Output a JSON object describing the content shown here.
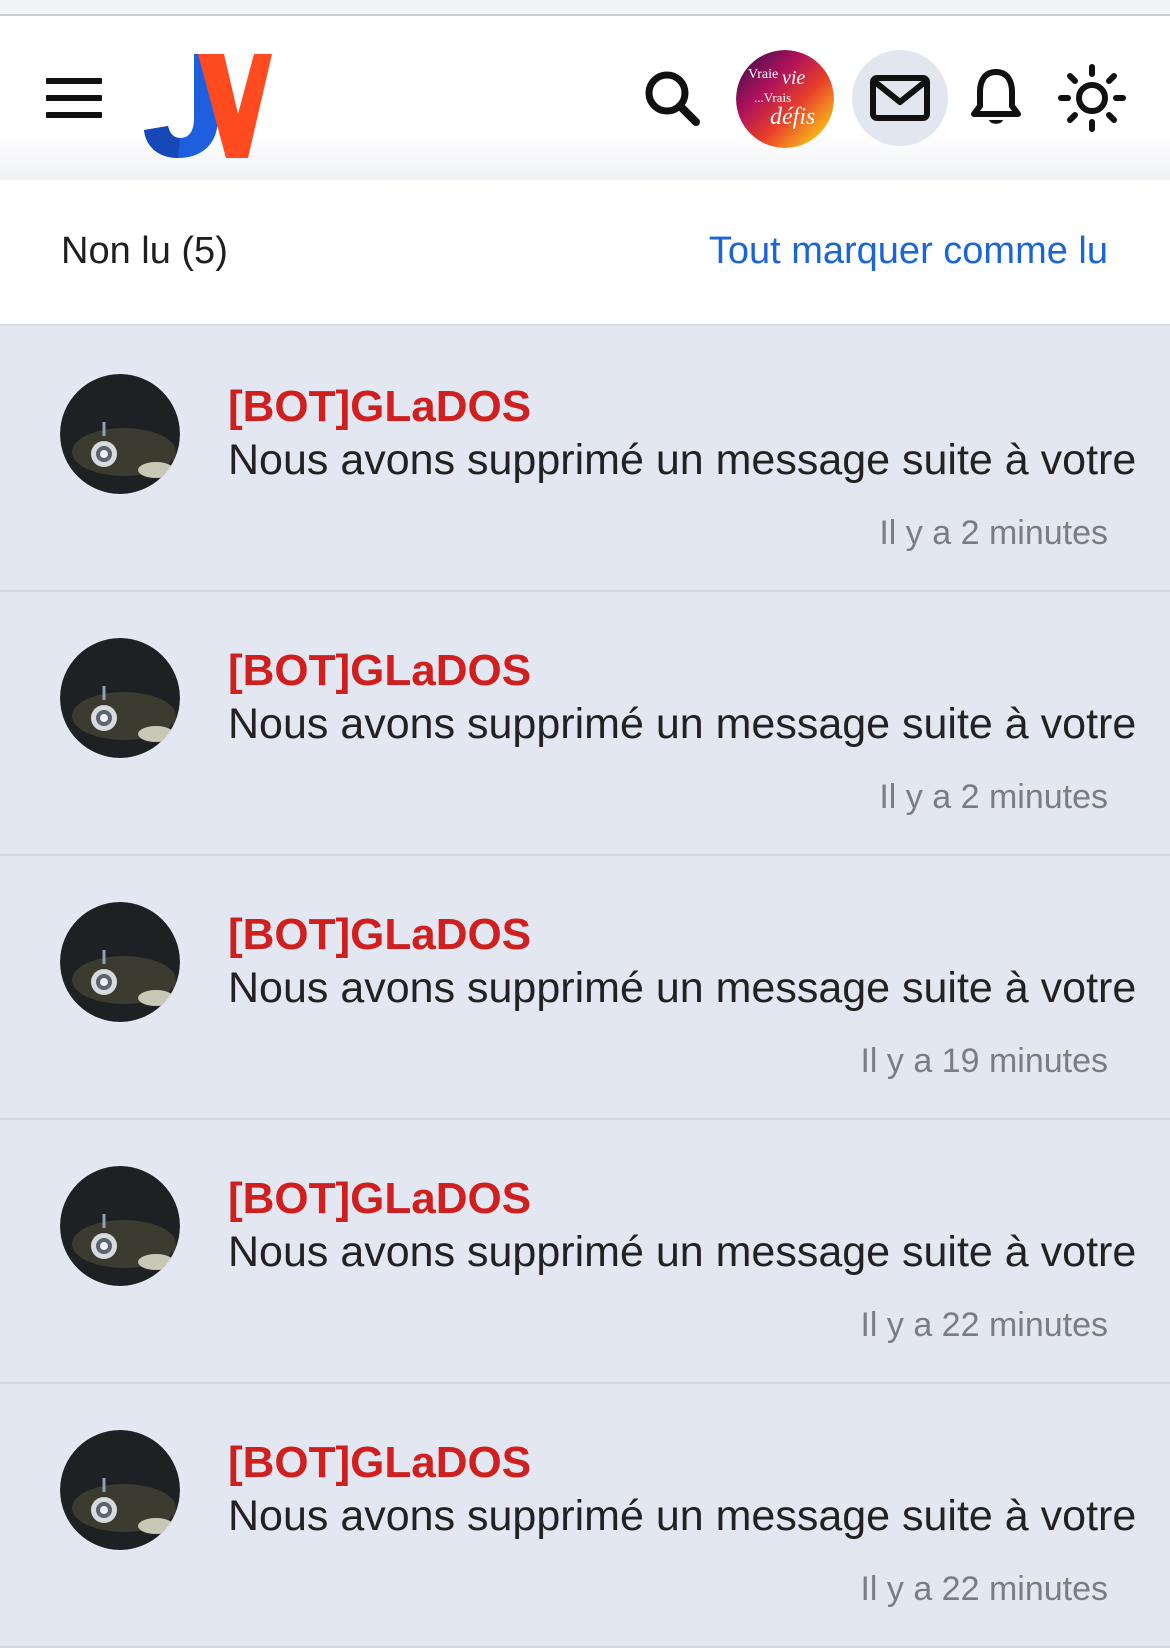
{
  "header": {
    "logo_text": "JV",
    "icons": [
      "menu-icon",
      "search-icon",
      "user-avatar",
      "mail-icon",
      "bell-icon",
      "sun-icon"
    ],
    "user_avatar_text": [
      "Vraie",
      "vie",
      "...Vrais",
      "défis"
    ]
  },
  "subbar": {
    "unread_label": "Non lu (5)",
    "mark_all_label": "Tout marquer comme lu"
  },
  "colors": {
    "sender": "#cf1f1f",
    "link": "#1a66d8",
    "unread_bg": "#e3e7f1"
  },
  "notifications": [
    {
      "sender": "[BOT]GLaDOS",
      "message": "Nous avons supprimé un message suite à votre",
      "time": "Il y a 2 minutes"
    },
    {
      "sender": "[BOT]GLaDOS",
      "message": "Nous avons supprimé un message suite à votre",
      "time": "Il y a 2 minutes"
    },
    {
      "sender": "[BOT]GLaDOS",
      "message": "Nous avons supprimé un message suite à votre",
      "time": "Il y a 19 minutes"
    },
    {
      "sender": "[BOT]GLaDOS",
      "message": "Nous avons supprimé un message suite à votre",
      "time": "Il y a 22 minutes"
    },
    {
      "sender": "[BOT]GLaDOS",
      "message": "Nous avons supprimé un message suite à votre",
      "time": "Il y a 22 minutes"
    }
  ]
}
